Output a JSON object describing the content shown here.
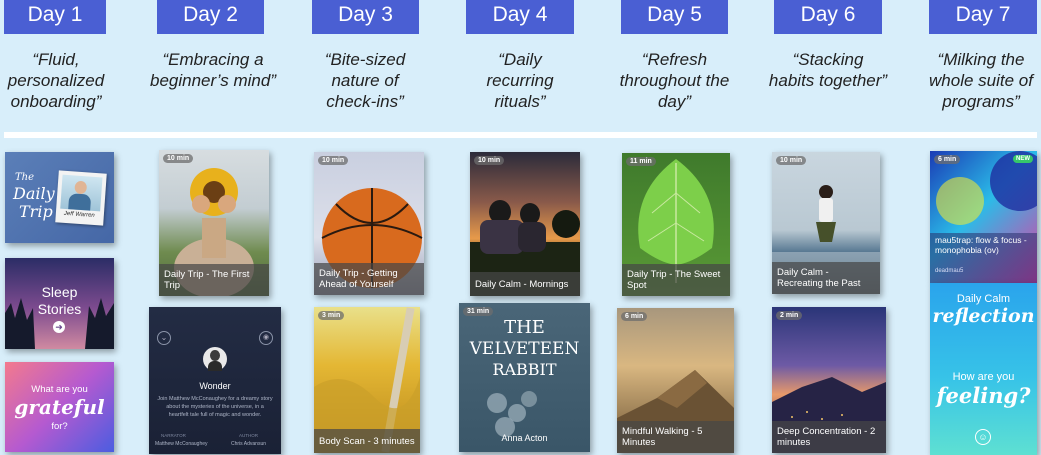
{
  "days": [
    {
      "label": "Day 1",
      "quote": "“Fluid, personalized onboarding”"
    },
    {
      "label": "Day 2",
      "quote": "“Embracing a beginner’s mind”"
    },
    {
      "label": "Day 3",
      "quote": "“Bite-sized nature of check-ins”"
    },
    {
      "label": "Day 4",
      "quote": "“Daily recurring rituals”"
    },
    {
      "label": "Day 5",
      "quote": "“Refresh throughout the day”"
    },
    {
      "label": "Day 6",
      "quote": "“Stacking habits together”"
    },
    {
      "label": "Day 7",
      "quote": "“Milking the whole suite of programs”"
    }
  ],
  "day1": {
    "daily_trip_line1": "The",
    "daily_trip_line2": "Daily",
    "daily_trip_line3": "Trip",
    "daily_trip_signature": "Jeff Warren",
    "sleep_title_1": "Sleep",
    "sleep_title_2": "Stories",
    "grateful_1": "What are you",
    "grateful_2": "grateful",
    "grateful_3": "for?"
  },
  "day2": {
    "card1_duration": "10 min",
    "card1_title": "Daily Trip - The First Trip",
    "wonder_title": "Wonder",
    "wonder_desc": "Join Matthew McConaughey for a dreamy story about the mysteries of the universe, in a heartfelt tale full of magic and wonder.",
    "wonder_narrator_label": "NARRATOR",
    "wonder_narrator": "Matthew McConaughey",
    "wonder_author_label": "AUTHOR",
    "wonder_author": "Chris Advansun"
  },
  "day3": {
    "card1_duration": "10 min",
    "card1_title": "Daily Trip - Getting Ahead of Yourself",
    "card2_duration": "3 min",
    "card2_title": "Body Scan - 3 minutes"
  },
  "day4": {
    "card1_duration": "10 min",
    "card1_title": "Daily Calm - Mornings",
    "card2_duration": "31 min",
    "card2_title_1": "THE",
    "card2_title_2": "VELVETEEN",
    "card2_title_3": "RABBIT",
    "card2_author": "Anna Acton"
  },
  "day5": {
    "card1_duration": "11 min",
    "card1_title": "Daily Trip - The Sweet Spot",
    "card2_duration": "6 min",
    "card2_title": "Mindful Walking - 5 Minutes"
  },
  "day6": {
    "card1_duration": "10 min",
    "card1_title": "Daily Calm - Recreating the Past",
    "card2_duration": "2 min",
    "card2_title": "Deep Concentration - 2 minutes"
  },
  "day7": {
    "card1_duration": "6 min",
    "card1_badge": "NEW",
    "card1_title": "mau5trap: flow & focus - monophobia (ov)",
    "card1_artist": "deadmau5",
    "reflection_1": "Daily Calm",
    "reflection_2": "reflection",
    "feeling_1": "How are you",
    "feeling_2": "feeling?"
  },
  "colors": {
    "background": "#d8eefa",
    "day_header": "#4a5fd3",
    "caption_overlay": "#464646"
  }
}
